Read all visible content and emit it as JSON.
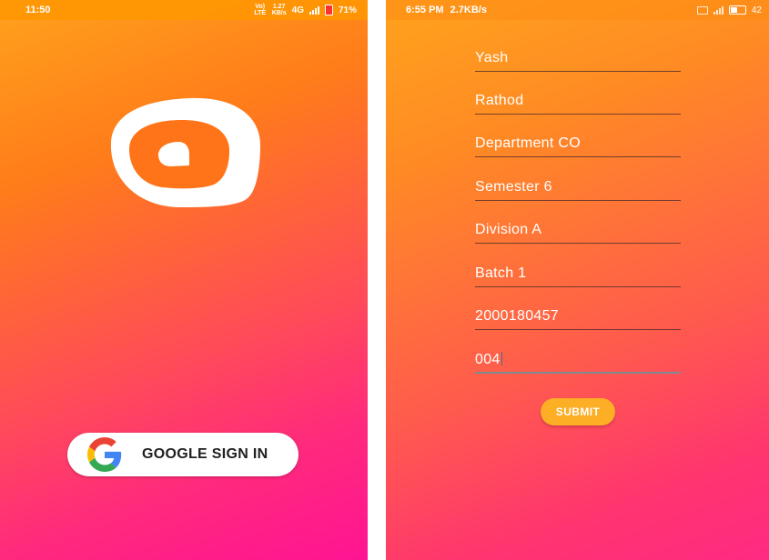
{
  "left_screen": {
    "status_bar": {
      "time": "11:50",
      "volte": "Vo) LTE",
      "net_speed": "1.27",
      "net_speed_unit": "KB/s",
      "network": "4G",
      "battery": "71%"
    },
    "google_sign_in": {
      "label": "GOOGLE SIGN IN",
      "icon": "google-g-icon"
    }
  },
  "right_screen": {
    "status_bar": {
      "time": "6:55 PM",
      "net_speed": "2.7KB/s",
      "battery": "42"
    },
    "form": {
      "fields": [
        {
          "value": "Yash"
        },
        {
          "value": "Rathod"
        },
        {
          "value": "Department CO"
        },
        {
          "value": "Semester 6"
        },
        {
          "value": "Division A"
        },
        {
          "value": "Batch 1"
        },
        {
          "value": "2000180457"
        },
        {
          "value": "004"
        }
      ],
      "submit_label": "SUBMIT"
    }
  },
  "colors": {
    "gradient_orange": "#ff7c1a",
    "gradient_pink": "#ff1493",
    "submit_button": "#fcae24",
    "google_blue": "#4285F4",
    "google_red": "#EA4335",
    "google_yellow": "#FBBC05",
    "google_green": "#34A853"
  }
}
